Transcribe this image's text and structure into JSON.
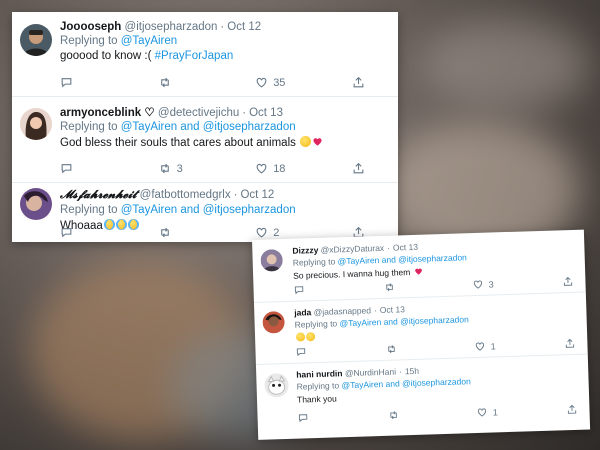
{
  "colors": {
    "link": "#1b95e0",
    "name": "#14171a",
    "meta": "#657786",
    "heart": "#e0245e"
  },
  "card1": {
    "tweets": [
      {
        "display_name": "Jooooseph",
        "handle": "@itjosepharzadon",
        "date": "Oct 12",
        "replying_label": "Replying to",
        "replying_to": "@TayAiren",
        "text": "gooood to know :(",
        "hashtag": "#PrayForJapan",
        "reply_count": "",
        "retweet_count": "",
        "like_count": "35"
      },
      {
        "display_name": "armyonceblink ♡",
        "handle": "@detectivejichu",
        "date": "Oct 13",
        "replying_label": "Replying to",
        "replying_to": "@TayAiren and @itjosepharzadon",
        "text": "God bless their souls that cares about animals",
        "emojis": [
          "smiling-face",
          "red-heart"
        ],
        "reply_count": "",
        "retweet_count": "3",
        "like_count": "18"
      },
      {
        "display_name": "𝓜𝓼𝓯𝓪𝓱𝓻𝓮𝓷𝓱𝓮𝓲𝓽",
        "handle": "@fatbottomedgrlx",
        "date": "Oct 12",
        "replying_label": "Replying to",
        "replying_to": "@TayAiren and @itjosepharzadon",
        "text": "Whoaaa",
        "emojis": [
          "crying-face",
          "crying-face",
          "crying-face"
        ],
        "reply_count": "",
        "retweet_count": "",
        "like_count": "2"
      }
    ]
  },
  "card2": {
    "tweets": [
      {
        "display_name": "Dizzzy",
        "handle": "@xDizzyDaturax",
        "date": "Oct 13",
        "replying_label": "Replying to",
        "replying_to": "@TayAiren and @itjosepharzadon",
        "text": "So precious. I wanna hug them",
        "emojis": [
          "red-heart"
        ],
        "reply_count": "",
        "retweet_count": "",
        "like_count": "3"
      },
      {
        "display_name": "jada",
        "handle": "@jadasnapped",
        "date": "Oct 13",
        "replying_label": "Replying to",
        "replying_to": "@TayAiren and @itjosepharzadon",
        "text": "",
        "emojis": [
          "smiling-face",
          "smiling-face"
        ],
        "reply_count": "",
        "retweet_count": "",
        "like_count": "1"
      },
      {
        "display_name": "hani nurdin",
        "handle": "@NurdinHani",
        "date": "15h",
        "replying_label": "Replying to",
        "replying_to": "@TayAiren and @itjosepharzadon",
        "text": "Thank you",
        "reply_count": "",
        "retweet_count": "",
        "like_count": "1"
      }
    ]
  },
  "icons": {
    "reply": "reply-icon",
    "retweet": "retweet-icon",
    "like": "heart-outline-icon",
    "share": "share-icon"
  }
}
